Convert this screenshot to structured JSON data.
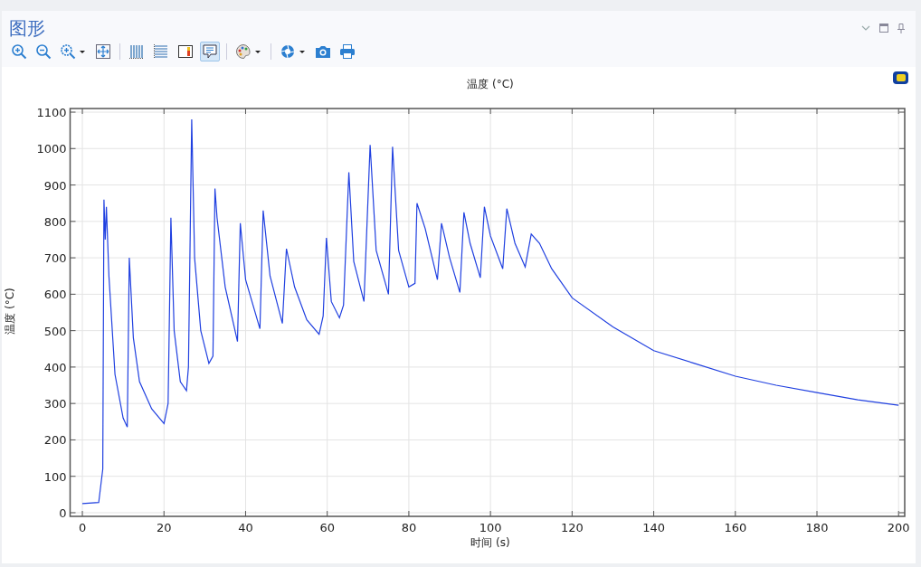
{
  "window": {
    "title": "图形"
  },
  "toolbar": [
    {
      "kind": "zoom-in",
      "selected": false
    },
    {
      "kind": "zoom-out",
      "selected": false
    },
    {
      "kind": "zoom-box",
      "selected": false
    },
    {
      "kind": "zoom-extents",
      "selected": false
    },
    {
      "kind": "sep"
    },
    {
      "kind": "x-grid",
      "selected": false
    },
    {
      "kind": "y-grid",
      "selected": false
    },
    {
      "kind": "color-legend",
      "selected": false
    },
    {
      "kind": "tooltip",
      "selected": true
    },
    {
      "kind": "sep"
    },
    {
      "kind": "palette",
      "selected": false
    },
    {
      "kind": "sep"
    },
    {
      "kind": "aperture",
      "selected": false
    },
    {
      "kind": "camera",
      "selected": false
    },
    {
      "kind": "printer",
      "selected": false
    }
  ],
  "plot": {
    "chart_data": {
      "type": "line",
      "title": "温度 (°C)",
      "xlabel": "时间 (s)",
      "ylabel": "温度 (°C)",
      "xlim": [
        -3,
        201.5
      ],
      "grid": true,
      "ylim": [
        -10,
        1110
      ],
      "xticks": [
        0,
        20,
        40,
        60,
        80,
        100,
        120,
        140,
        160,
        180,
        200
      ],
      "yticks": [
        0,
        100,
        200,
        300,
        400,
        500,
        600,
        700,
        800,
        900,
        1000,
        1100
      ],
      "x": [
        0,
        4,
        5,
        5.3,
        5.6,
        5.9,
        6.5,
        8,
        10,
        11,
        11.5,
        12.5,
        14,
        17,
        20,
        21,
        21.7,
        22.5,
        24,
        25.5,
        26,
        26.8,
        27.5,
        29,
        31,
        32,
        32.5,
        33,
        35,
        38,
        38.7,
        40,
        43.5,
        44.3,
        46,
        49,
        50,
        52,
        55,
        58,
        59,
        59.8,
        61,
        63,
        64,
        65.3,
        66.5,
        69,
        70.5,
        72,
        75,
        76,
        77.5,
        80,
        81.5,
        82,
        84,
        87,
        88,
        90,
        92.5,
        93.5,
        95,
        97.5,
        98.5,
        100,
        103,
        104,
        106,
        108.5,
        110,
        112,
        115,
        120,
        130,
        140,
        150,
        160,
        170,
        180,
        190,
        200
      ],
      "series": [
        {
          "color": "#2040e0",
          "values": [
            25,
            28,
            120,
            860,
            750,
            840,
            650,
            380,
            260,
            235,
            700,
            480,
            360,
            285,
            245,
            300,
            810,
            500,
            360,
            335,
            400,
            1080,
            700,
            500,
            410,
            430,
            890,
            810,
            620,
            470,
            795,
            640,
            505,
            830,
            650,
            520,
            725,
            620,
            530,
            490,
            540,
            755,
            580,
            535,
            570,
            935,
            690,
            580,
            1010,
            720,
            600,
            1005,
            720,
            620,
            630,
            850,
            780,
            640,
            795,
            700,
            605,
            825,
            740,
            645,
            840,
            760,
            670,
            835,
            740,
            675,
            765,
            740,
            670,
            590,
            510,
            445,
            410,
            375,
            350,
            330,
            310,
            295
          ]
        }
      ]
    }
  }
}
